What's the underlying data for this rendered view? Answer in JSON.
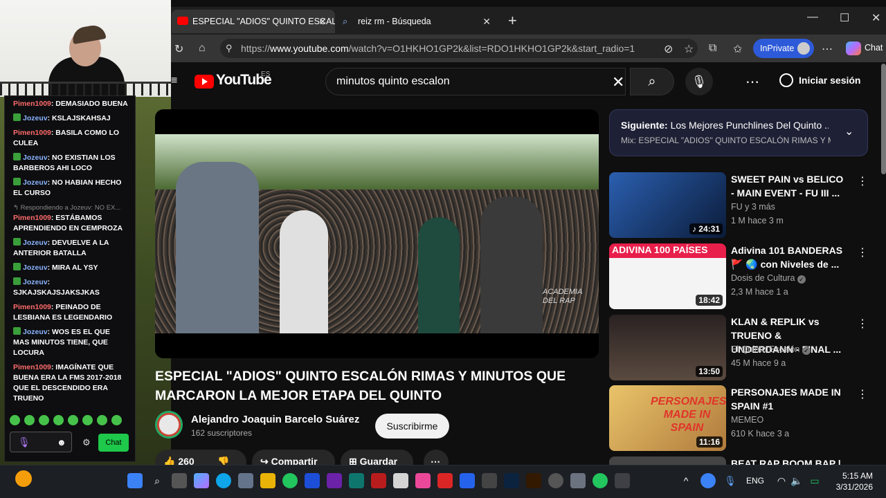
{
  "chat": {
    "messages": [
      {
        "user": "Pimen1009",
        "text": "DEMASIADO BUENA",
        "style": "u1"
      },
      {
        "user": "Jozeuv",
        "text": "KSLAJSKAHSAJ",
        "style": "u2"
      },
      {
        "user": "Pimen1009",
        "text": "BASILA COMO LO CULEA",
        "style": "u1"
      },
      {
        "user": "Jozeuv",
        "text": "NO EXISTIAN LOS BARBEROS AHI LOCO",
        "style": "u2"
      },
      {
        "user": "Jozeuv",
        "text": "NO HABIAN HECHO EL CURSO",
        "style": "u2"
      },
      {
        "reply": "Respondiendo a Jozeuv: NO EX..."
      },
      {
        "user": "Pimen1009",
        "text": "ESTÁBAMOS APRENDIENDO EN CEMPROZA",
        "style": "u1"
      },
      {
        "user": "Jozeuv",
        "text": "DEVUELVE A LA ANTERIOR BATALLA",
        "style": "u2"
      },
      {
        "user": "Jozeuv",
        "text": "MIRA AL YSY",
        "style": "u2"
      },
      {
        "user": "Jozeuv",
        "text": "SJKAJSKAJSJAKSJKAS",
        "style": "u2"
      },
      {
        "user": "Pimen1009",
        "text": "PEINADO DE LESBIANA ES LEGENDARIO",
        "style": "u1"
      },
      {
        "user": "Jozeuv",
        "text": "WOS ES EL QUE MAS MINUTOS TIENE, QUE LOCURA",
        "style": "u2"
      },
      {
        "user": "Pimen1009",
        "text": "IMAGÍNATE QUE BUENA ERA LA FMS 2017-2018 QUE EL DESCENDIDO ERA TRUENO",
        "style": "u1"
      }
    ],
    "send_label": "Chat"
  },
  "browser": {
    "tabs": [
      {
        "label": "ESPECIAL \"ADIOS\" QUINTO ESCAL"
      },
      {
        "label": "reiz rm - Búsqueda"
      }
    ],
    "url_prefix": "https://",
    "url_host": "www.youtube.com",
    "url_path": "/watch?v=O1HKHO1GP2k&list=RDO1HKHO1GP2k&start_radio=1",
    "inprivate_label": "InPrivate",
    "copilot_label": "Chat"
  },
  "youtube": {
    "logo_text": "YouTube",
    "region": "ES",
    "search_value": "minutos quinto escalon",
    "signin_label": "Iniciar sesión",
    "video_title": "ESPECIAL \"ADIOS\" QUINTO ESCALÓN RIMAS Y MINUTOS QUE MARCARON LA MEJOR ETAPA DEL QUINTO",
    "watermark": "ACADEMIA DEL RAP",
    "channel_name": "Alejandro Joaquin Barcelo Suárez",
    "subscribers": "162 suscriptores",
    "subscribe_label": "Suscribirme",
    "likes": "260",
    "share_label": "Compartir",
    "save_label": "Guardar",
    "upnext_prefix": "Siguiente:",
    "upnext_title": "Los Mejores Punchlines Del Quinto ...",
    "upnext_mix": "Mix: ESPECIAL \"ADIOS\" QUINTO ESCALÓN RIMAS Y MINUTOS",
    "related": [
      {
        "title": "SWEET PAIN vs BELICO - MAIN EVENT - FU III ...",
        "channel": "FU y 3 más",
        "meta": "1 M   hace 3 m",
        "duration": "♪ 24:31",
        "colors": [
          "#2b5fb0",
          "#0b1c3a"
        ]
      },
      {
        "title": "Adivina 101 BANDERAS 🚩 🌏 con Niveles de ...",
        "channel": "Dosis de Cultura",
        "meta": "2,3 M   hace 1 a",
        "duration": "18:42",
        "thumb_text": "ADIVINA 100 PAÍSES",
        "colors": [
          "#e81e4b",
          "#f4f4f4"
        ]
      },
      {
        "title": "KLAN & REPLIK vs TRUENO & UNDERDANN - FINAL ...",
        "channel": "El Quinto Escalón",
        "meta": "45 M   hace 9 a",
        "duration": "13:50",
        "colors": [
          "#3a2a2a",
          "#1a1212"
        ]
      },
      {
        "title": "PERSONAJES MADE IN SPAIN #1",
        "channel": "MEMEO",
        "meta": "610 K   hace 3 a",
        "duration": "11:16",
        "thumb_text": "PERSONAJES MADE IN SPAIN",
        "colors": [
          "#e9c46a",
          "#b07a3c"
        ]
      },
      {
        "title": "BEAT RAP BOOM BAP |",
        "channel": "",
        "meta": "",
        "duration": "",
        "colors": [
          "#444",
          "#222"
        ]
      }
    ]
  },
  "taskbar": {
    "language": "ENG",
    "time": "5:15 AM",
    "date": "3/31/2026"
  }
}
